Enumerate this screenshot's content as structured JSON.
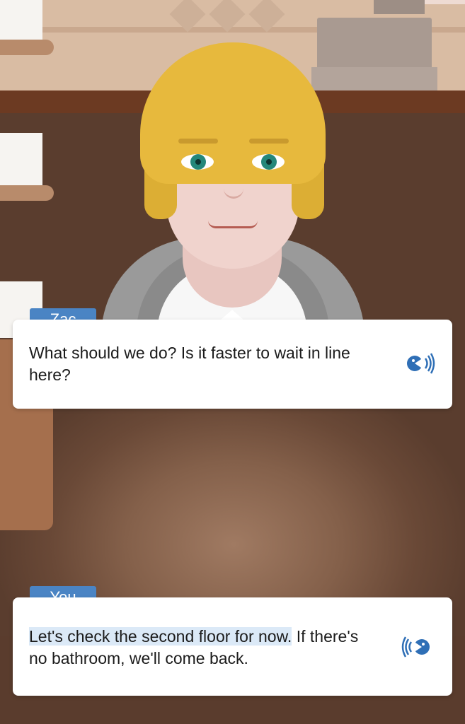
{
  "conversation": {
    "npc": {
      "speaker": "Zac",
      "message": "What should we do? Is it faster to wait in line here?",
      "audio_icon": "speaker-audio-icon"
    },
    "user": {
      "speaker": "You",
      "highlighted_text": "Let's check the second floor for now.",
      "rest_text": " If there's no bathroom, we'll come back.",
      "audio_icon": "microphone-audio-icon"
    }
  },
  "colors": {
    "tag_blue": "#4a84c4",
    "icon_blue": "#2f6fb6",
    "highlight": "#dbe9f7"
  }
}
